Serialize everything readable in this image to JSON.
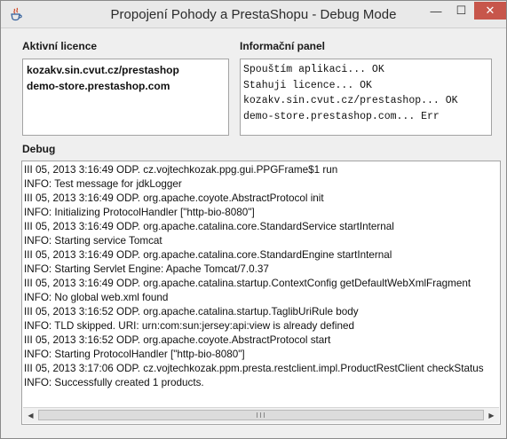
{
  "window": {
    "title": "Propojení Pohody a PrestaShopu - Debug Mode",
    "icon": "java-app-icon",
    "controls": {
      "minimize": "—",
      "maximize": "☐",
      "close": "✕"
    }
  },
  "licences": {
    "label": "Aktivní licence",
    "items": [
      "kozakv.sin.cvut.cz/prestashop",
      "demo-store.prestashop.com"
    ]
  },
  "info_panel": {
    "label": "Informační panel",
    "lines": [
      "Spouštím aplikaci... OK",
      "Stahuji licence... OK",
      "kozakv.sin.cvut.cz/prestashop... OK",
      "demo-store.prestashop.com... Err"
    ]
  },
  "debug": {
    "label": "Debug",
    "lines": [
      "III 05, 2013 3:16:49 ODP. cz.vojtechkozak.ppg.gui.PPGFrame$1 run",
      "INFO: Test message for jdkLogger",
      "III 05, 2013 3:16:49 ODP. org.apache.coyote.AbstractProtocol init",
      "INFO: Initializing ProtocolHandler [\"http-bio-8080\"]",
      "III 05, 2013 3:16:49 ODP. org.apache.catalina.core.StandardService startInternal",
      "INFO: Starting service Tomcat",
      "III 05, 2013 3:16:49 ODP. org.apache.catalina.core.StandardEngine startInternal",
      "INFO: Starting Servlet Engine: Apache Tomcat/7.0.37",
      "III 05, 2013 3:16:49 ODP. org.apache.catalina.startup.ContextConfig getDefaultWebXmlFragment",
      "INFO: No global web.xml found",
      "III 05, 2013 3:16:52 ODP. org.apache.catalina.startup.TaglibUriRule body",
      "INFO: TLD skipped. URI: urn:com:sun:jersey:api:view is already defined",
      "III 05, 2013 3:16:52 ODP. org.apache.coyote.AbstractProtocol start",
      "INFO: Starting ProtocolHandler [\"http-bio-8080\"]",
      "III 05, 2013 3:17:06 ODP. cz.vojtechkozak.ppm.presta.restclient.impl.ProductRestClient checkStatus",
      "INFO: Successfully created 1 products."
    ],
    "scrollbar": {
      "left_arrow": "◀",
      "right_arrow": "▶"
    }
  }
}
